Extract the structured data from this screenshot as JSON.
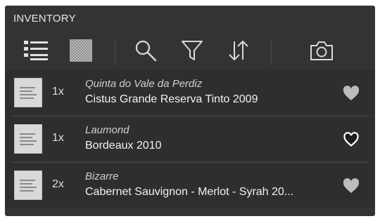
{
  "header": {
    "title": "INVENTORY"
  },
  "toolbar": {
    "icons": [
      "list-view-icon",
      "grid-view-icon",
      "search-icon",
      "filter-icon",
      "sort-icon",
      "camera-icon"
    ]
  },
  "colors": {
    "panel_bg": "#333333",
    "row_bg": "#2e2e2e",
    "text": "#f2f2f2",
    "heart_gray": "#bdbdbd",
    "heart_outline": "#ffffff"
  },
  "items": [
    {
      "qty": "1x",
      "producer": "Quinta do Vale da Perdiz",
      "wine": "Cistus Grande Reserva Tinto 2009",
      "favorite": false
    },
    {
      "qty": "1x",
      "producer": "Laumond",
      "wine": "Bordeaux 2010",
      "favorite": true
    },
    {
      "qty": "2x",
      "producer": "Bizarre",
      "wine": "Cabernet Sauvignon - Merlot - Syrah 20...",
      "favorite": false
    }
  ]
}
